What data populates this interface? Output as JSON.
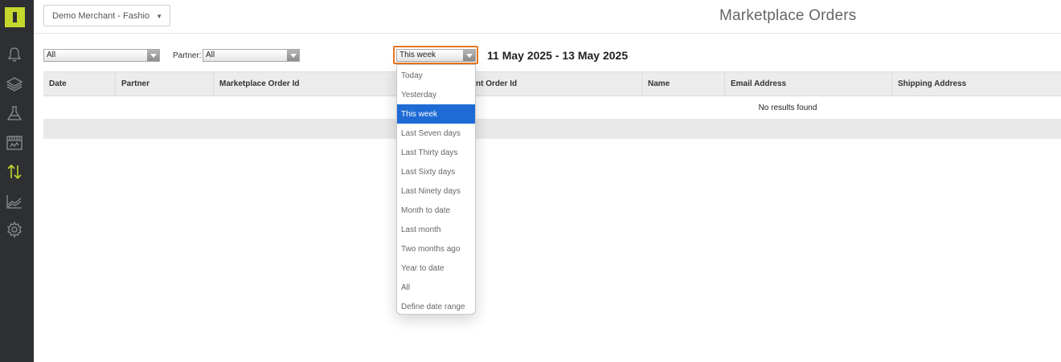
{
  "sidebar": {
    "logo": "app-logo",
    "icons": [
      "bell-icon",
      "layers-icon",
      "flask-icon",
      "store-icon",
      "transfer-arrows-icon",
      "area-chart-icon",
      "gear-icon"
    ],
    "active": "transfer-arrows-icon",
    "accent_color": "#c5d72c",
    "bg_color": "#2d2f33"
  },
  "header": {
    "merchant_select": "Demo Merchant - Fashio",
    "title": "Marketplace Orders"
  },
  "filters": {
    "status_value": "All",
    "partner_label": "Partner:",
    "partner_value": "All",
    "period_value": "This week",
    "date_range": "11 May 2025 - 13 May 2025"
  },
  "table": {
    "columns": [
      "Date",
      "Partner",
      "Marketplace Order Id",
      "Merchant Order Id",
      "Name",
      "Email Address",
      "Shipping Address"
    ],
    "merchant_order_visible": "nt Order Id",
    "empty_message": "No results found"
  },
  "period_dropdown": {
    "options": [
      "Today",
      "Yesterday",
      "This week",
      "Last Seven days",
      "Last Thirty days",
      "Last Sixty days",
      "Last Ninety days",
      "Month to date",
      "Last month",
      "Two months ago",
      "Year to date",
      "All",
      "Define date range"
    ],
    "selected": "This week",
    "highlight_color": "#1e6bd6",
    "focus_color": "#e87722"
  }
}
